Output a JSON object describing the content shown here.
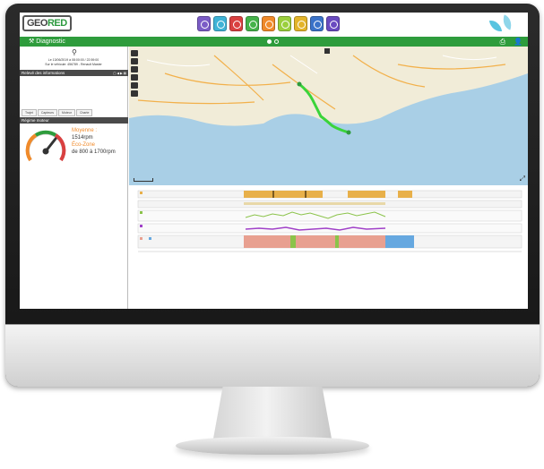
{
  "header": {
    "logo_text_1": "GEO",
    "logo_text_2": "RED",
    "modules": [
      {
        "icon": "clock-icon",
        "color": "#7b5cc6"
      },
      {
        "icon": "gauge-icon",
        "color": "#3fb3d6"
      },
      {
        "icon": "speedometer-icon",
        "color": "#d94040"
      },
      {
        "icon": "chart-icon",
        "color": "#45b24a"
      },
      {
        "icon": "report-icon",
        "color": "#f08a2a"
      },
      {
        "icon": "list-icon",
        "color": "#9bcf3c"
      },
      {
        "icon": "download-icon",
        "color": "#e3b42a"
      },
      {
        "icon": "mail-icon",
        "color": "#3b73c9"
      },
      {
        "icon": "search-icon",
        "color": "#6a4bc0"
      }
    ]
  },
  "navbar": {
    "title": "Diagnostic",
    "print_icon": "print-icon",
    "user_icon": "user-icon"
  },
  "panel": {
    "date_line_1": "Le 13/06/2019 à 08:00:00 / 22:59:00",
    "date_line_2": "Sur le véhicule: 456789 - Renault Master",
    "section_title": "Relevé des informations",
    "sub_title": "Régime moteur",
    "tabs": [
      "Trajet",
      "Capteurs",
      "Moteur",
      "Charte"
    ],
    "gauge_label_avg": "Moyenne :",
    "gauge_value": "1514rpm",
    "gauge_label_range": "Éco-Zone",
    "gauge_range": "de 800 à 1700rpm",
    "colors": {
      "avg": "#f08a2a",
      "range": "#f08a2a"
    }
  },
  "timeline": {
    "tracks": [
      "",
      "",
      "",
      "",
      "",
      ""
    ],
    "colors": {
      "track1": "#e8b04a",
      "track2": "#e8b04a",
      "track3": "#8bc34a",
      "track4": "#a040c8",
      "track5": "#e8a090",
      "track6": "#66a8e0"
    }
  }
}
